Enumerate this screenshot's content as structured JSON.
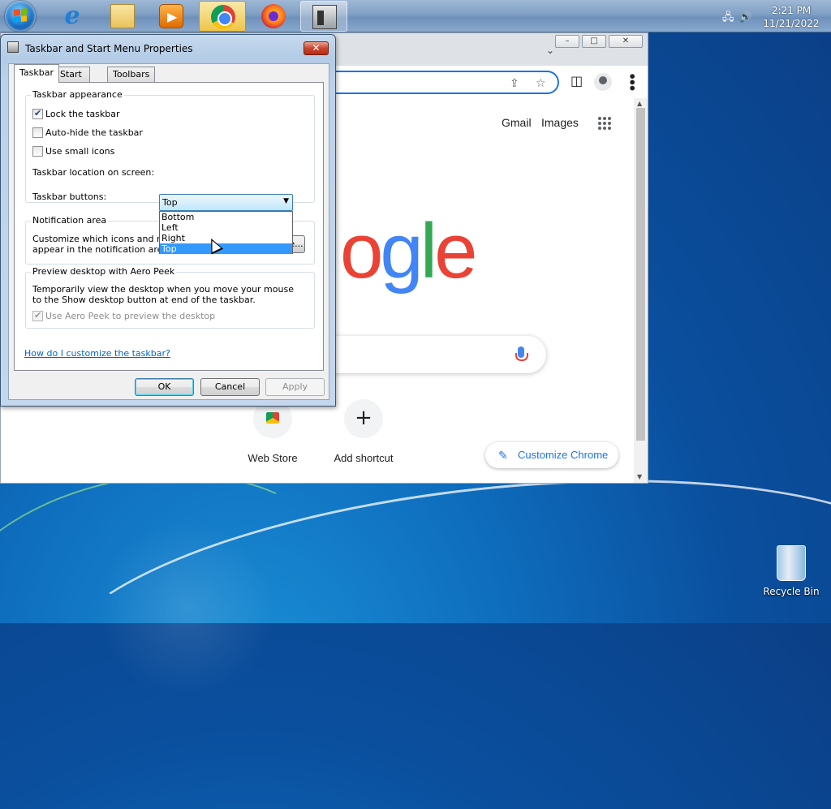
{
  "taskbar": {
    "clock_time": "2:21 PM",
    "clock_date": "11/21/2022",
    "tray_icons": [
      "network-icon",
      "volume-icon"
    ],
    "apps": [
      "internet-explorer",
      "windows-explorer",
      "media-player",
      "google-chrome",
      "firefox",
      "taskbar-properties"
    ]
  },
  "chrome": {
    "window_controls": {
      "minimize": "–",
      "maximize": "□",
      "close": "✕"
    },
    "tab_search_icon": "⌄",
    "header_links": [
      "Gmail",
      "Images"
    ],
    "logo_text": [
      "o",
      "g",
      "l",
      "e"
    ],
    "logo_colors": [
      "#ea4335",
      "#4285f4",
      "#34a853",
      "#ea4335"
    ],
    "shortcuts": [
      {
        "label": "Web Store"
      },
      {
        "label": "Add shortcut",
        "icon_text": "+"
      }
    ],
    "customize_label": "Customize Chrome",
    "pencil_icon": "✎"
  },
  "dialog": {
    "title": "Taskbar and Start Menu Properties",
    "close_glyph": "✕",
    "tabs": [
      "Taskbar",
      "Start Menu",
      "Toolbars"
    ],
    "appearance": {
      "title": "Taskbar appearance",
      "lock": {
        "label": "Lock the taskbar",
        "checked": true
      },
      "autohide": {
        "label": "Auto-hide the taskbar",
        "checked": false
      },
      "small_icons": {
        "label": "Use small icons",
        "checked": false
      },
      "location_label": "Taskbar location on screen:",
      "location_value": "Top",
      "location_options": [
        "Bottom",
        "Left",
        "Right",
        "Top"
      ],
      "buttons_label": "Taskbar buttons:"
    },
    "notification": {
      "title": "Notification area",
      "text": "Customize which icons and notifications appear in the notification area.",
      "customize_button": "Customize..."
    },
    "aero": {
      "title": "Preview desktop with Aero Peek",
      "text": "Temporarily view the desktop when you move your mouse to the Show desktop button at end of the taskbar.",
      "checkbox_label": "Use Aero Peek to preview the desktop",
      "checked": true
    },
    "help_link": "How do I customize the taskbar?",
    "ok": "OK",
    "cancel": "Cancel",
    "apply": "Apply"
  },
  "desktop": {
    "recycle_bin_label": "Recycle Bin"
  }
}
